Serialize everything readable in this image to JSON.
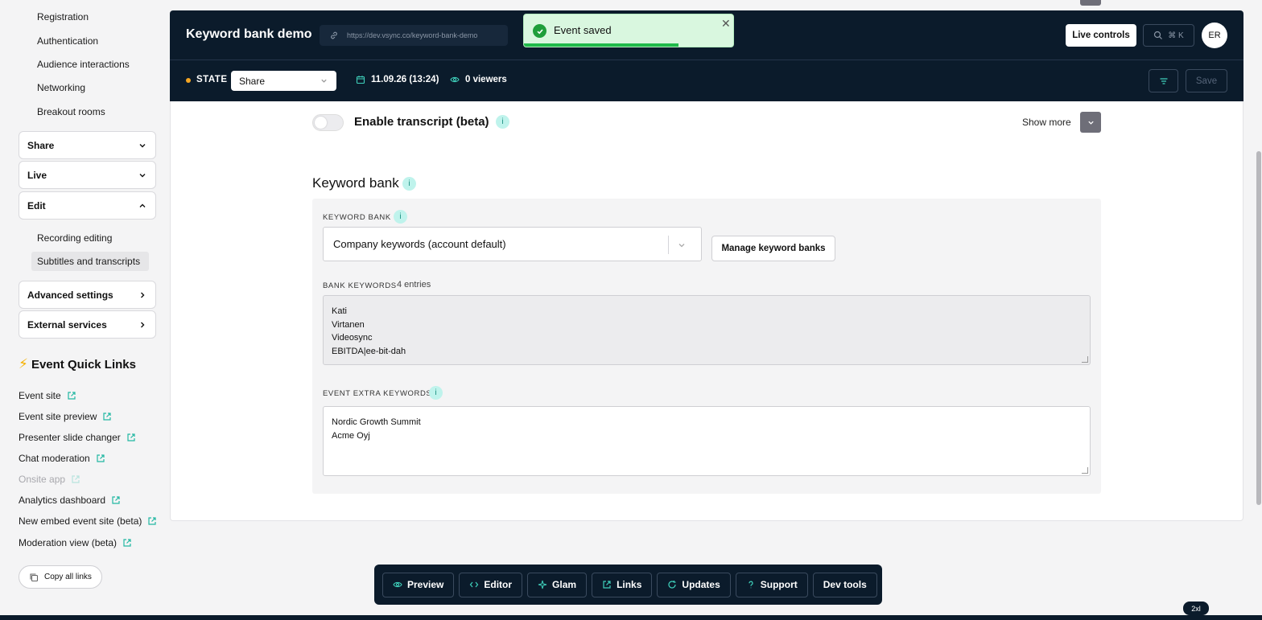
{
  "sidebar": {
    "register_items": [
      "Registration",
      "Authentication",
      "Audience interactions",
      "Networking",
      "Breakout rooms"
    ],
    "sections": {
      "share": "Share",
      "live": "Live",
      "edit": "Edit",
      "advanced": "Advanced settings",
      "external": "External services"
    },
    "edit_items": [
      "Recording editing",
      "Subtitles and transcripts"
    ],
    "quick_links_title": "Event Quick Links",
    "quick_links": [
      "Event site",
      "Event site preview",
      "Presenter slide changer",
      "Chat moderation",
      "Onsite app",
      "Analytics dashboard",
      "New embed event site (beta)",
      "Moderation view (beta)"
    ],
    "copy_all": "Copy all links"
  },
  "header": {
    "title": "Keyword bank demo",
    "url": "https://dev.vsync.co/keyword-bank-demo",
    "live_controls": "Live controls",
    "search_shortcut": "⌘ K",
    "avatar": "ER",
    "state_label": "STATE",
    "state_value": "Share",
    "date": "11.09.26 (13:24)",
    "viewers": "0 viewers",
    "save": "Save"
  },
  "toast": {
    "message": "Event saved",
    "progress_percent": 74
  },
  "transcript": {
    "label": "Enable transcript (beta)",
    "enabled": false,
    "show_more": "Show more"
  },
  "keyword_bank": {
    "title": "Keyword bank",
    "field_label": "KEYWORD BANK",
    "selected": "Company keywords (account default)",
    "manage": "Manage keyword banks",
    "bank_keywords_label": "BANK KEYWORDS",
    "entries": "4 entries",
    "bank_keywords": [
      "Kati",
      "Virtanen",
      "Videosync",
      "EBITDA|ee-bit-dah"
    ],
    "extra_label": "EVENT EXTRA KEYWORDS",
    "extra_keywords": [
      "Nordic Growth Summit",
      "Acme Oyj"
    ]
  },
  "dock": {
    "buttons": [
      "Preview",
      "Editor",
      "Glam",
      "Links",
      "Updates",
      "Support",
      "Dev tools"
    ]
  },
  "size_badge": "2xl",
  "colors": {
    "navy": "#0b1b2b",
    "accent": "#3fd0bb",
    "success": "#1fba4a",
    "state_dot": "#f5a623"
  }
}
